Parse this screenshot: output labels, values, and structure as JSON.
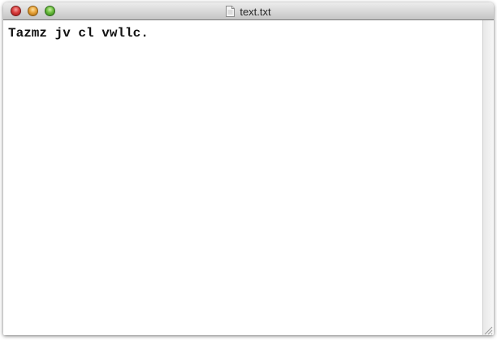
{
  "window": {
    "title": "text.txt",
    "file_icon": "document-icon"
  },
  "controls": {
    "close": "close-icon",
    "minimize": "minimize-icon",
    "zoom": "zoom-icon"
  },
  "editor": {
    "content": "Tazmz jv cl vwllc."
  },
  "colors": {
    "close": "#d93e3e",
    "minimize": "#e7a238",
    "zoom": "#6bbd3d",
    "titlebar": "#d9d9d9"
  }
}
